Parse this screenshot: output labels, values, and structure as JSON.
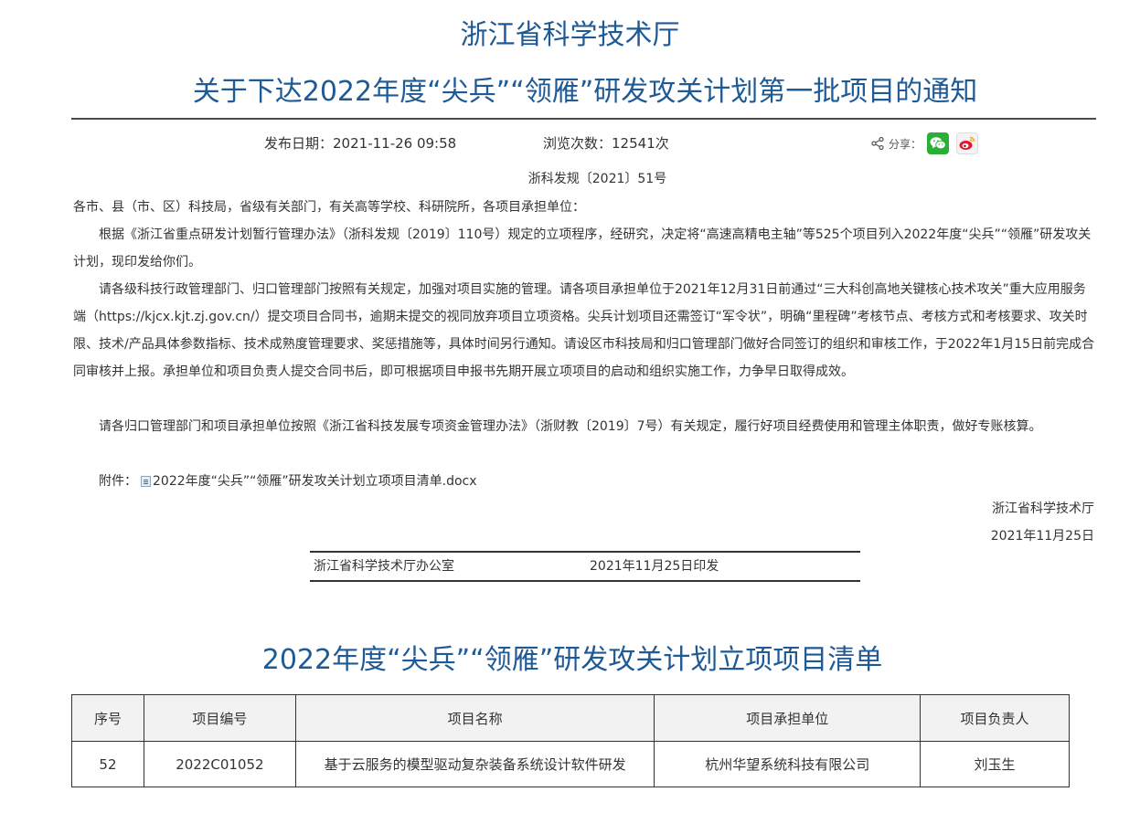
{
  "header": {
    "agency": "浙江省科学技术厅",
    "title": "关于下达2022年度“尖兵”“领雁”研发攻关计划第一批项目的通知"
  },
  "meta": {
    "publish_label": "发布日期：",
    "publish_date": "2021-11-26 09:58",
    "views_label": "浏览次数：",
    "views": "12541次",
    "share_label": "分享："
  },
  "document": {
    "doc_number": "浙科发规〔2021〕51号",
    "addressee": "各市、县（市、区）科技局，省级有关部门，有关高等学校、科研院所，各项目承担单位：",
    "paragraphs": [
      "根据《浙江省重点研发计划暂行管理办法》（浙科发规〔2019〕110号）规定的立项程序，经研究，决定将“高速高精电主轴”等525个项目列入2022年度“尖兵”“领雁”研发攻关计划，现印发给你们。",
      "请各级科技行政管理部门、归口管理部门按照有关规定，加强对项目实施的管理。请各项目承担单位于2021年12月31日前通过“三大科创高地关键核心技术攻关”重大应用服务端（https://kjcx.kjt.zj.gov.cn/）提交项目合同书，逾期未提交的视同放弃项目立项资格。尖兵计划项目还需签订“军令状”，明确“里程碑”考核节点、考核方式和考核要求、攻关时限、技术/产品具体参数指标、技术成熟度管理要求、奖惩措施等，具体时间另行通知。请设区市科技局和归口管理部门做好合同签订的组织和审核工作，于2022年1月15日前完成合同审核并上报。承担单位和项目负责人提交合同书后，即可根据项目申报书先期开展立项项目的启动和组织实施工作，力争早日取得成效。",
      "请各归口管理部门和项目承担单位按照《浙江省科技发展专项资金管理办法》（浙财教〔2019〕7号）有关规定，履行好项目经费使用和管理主体职责，做好专账核算。"
    ],
    "attachment_label": "附件：",
    "attachment_file": "2022年度“尖兵”“领雁”研发攻关计划立项项目清单.docx",
    "sign_org": "浙江省科学技术厅",
    "sign_date": "2021年11月25日"
  },
  "footer": {
    "office": "浙江省科学技术厅办公室",
    "issued": "2021年11月25日印发"
  },
  "project_list": {
    "title": "2022年度“尖兵”“领雁”研发攻关计划立项项目清单",
    "columns": [
      "序号",
      "项目编号",
      "项目名称",
      "项目承担单位",
      "项目负责人"
    ],
    "rows": [
      [
        "52",
        "2022C01052",
        "基于云服务的模型驱动复杂装备系统设计软件研发",
        "杭州华望系统科技有限公司",
        "刘玉生"
      ]
    ]
  },
  "colors": {
    "title_blue": "#1e5a96",
    "wechat_green": "#2aae35",
    "weibo_red": "#e6162d"
  },
  "icons": [
    "share-icon",
    "wechat-icon",
    "weibo-icon",
    "doc-file-icon"
  ]
}
